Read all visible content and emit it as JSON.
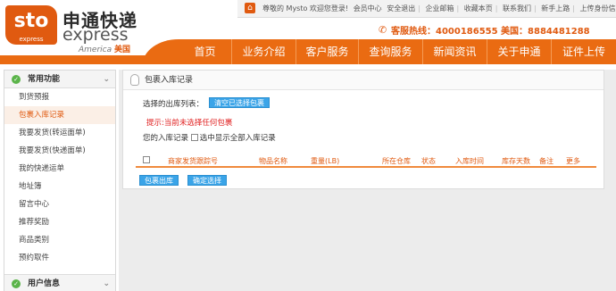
{
  "logo": {
    "badge": "sto",
    "badge_sub": "express",
    "cn": "申通快递",
    "en": "express",
    "america": "America",
    "america_cn": "美国"
  },
  "topbar": {
    "links": [
      "尊敬的 Mysto 欢迎您登录!",
      "会员中心",
      "安全退出",
      "企业邮箱",
      "收藏本页",
      "联系我们",
      "新手上路",
      "上传身份信息"
    ]
  },
  "hotline": "客服热线：4000186555 美国：8884481288",
  "nav": {
    "items": [
      "首页",
      "业务介绍",
      "客户服务",
      "查询服务",
      "新闻资讯",
      "关于申通",
      "证件上传"
    ]
  },
  "sidebar": {
    "section_title": "常用功能",
    "items": [
      "到货预报",
      "包裹入库记录",
      "我要发货(转运面单)",
      "我要发货(快递面单)",
      "我的快递运单",
      "地址簿",
      "留言中心",
      "推荐奖励",
      "商品类别",
      "预约取件"
    ],
    "active_index": 1,
    "bottom_section_title": "用户信息"
  },
  "panel": {
    "title": "包裹入库记录",
    "selected_label": "选择的出库列表：",
    "clear_button": "清空已选择包裹",
    "warning": "提示:当前未选择任何包裹",
    "records_label": "您的入库记录",
    "show_all_label": "选中显示全部入库记录",
    "columns": [
      "商家发货跟踪号",
      "物品名称",
      "重量(LB)",
      "所在仓库",
      "状态",
      "入库时间",
      "库存天数",
      "备注",
      "更多"
    ],
    "outbound_button": "包裹出库",
    "confirm_button": "确定选择"
  },
  "colors": {
    "brand_orange": "#ea6b12",
    "button_blue": "#3aa4e8",
    "warning_red": "#e02020",
    "sidebar_green": "#5bb44a"
  }
}
